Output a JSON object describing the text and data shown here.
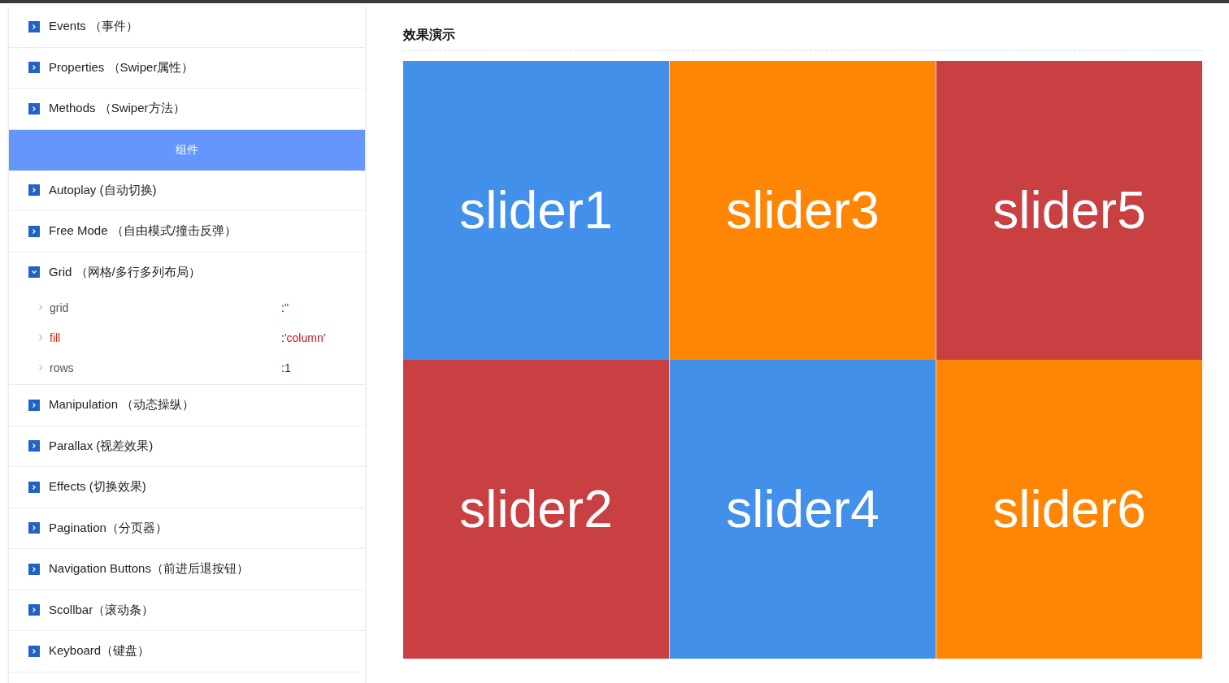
{
  "sidebar": {
    "items": [
      {
        "kind": "section",
        "label": "Events （事件）",
        "expanded": false
      },
      {
        "kind": "section",
        "label": "Properties （Swiper属性）",
        "expanded": false
      },
      {
        "kind": "section",
        "label": "Methods （Swiper方法）",
        "expanded": false
      },
      {
        "kind": "header",
        "label": "组件"
      },
      {
        "kind": "section",
        "label": "Autoplay (自动切换)",
        "expanded": false
      },
      {
        "kind": "section",
        "label": "Free Mode （自由模式/撞击反弹）",
        "expanded": false
      },
      {
        "kind": "section",
        "label": "Grid （网格/多行多列布局）",
        "expanded": true,
        "children": [
          {
            "key": "grid",
            "separator": ":",
            "value": "''",
            "kind": "string",
            "highlighted": false
          },
          {
            "key": "fill",
            "separator": ":",
            "value": "'column'",
            "kind": "string",
            "highlighted": true
          },
          {
            "key": "rows",
            "separator": ":",
            "value": "1",
            "kind": "number",
            "highlighted": false
          }
        ]
      },
      {
        "kind": "section",
        "label": "Manipulation （动态操纵）",
        "expanded": false
      },
      {
        "kind": "section",
        "label": "Parallax (视差效果)",
        "expanded": false
      },
      {
        "kind": "section",
        "label": "Effects (切换效果)",
        "expanded": false
      },
      {
        "kind": "section",
        "label": "Pagination（分页器）",
        "expanded": false
      },
      {
        "kind": "section",
        "label": "Navigation Buttons（前进后退按钮）",
        "expanded": false
      },
      {
        "kind": "section",
        "label": "Scollbar（滚动条）",
        "expanded": false
      },
      {
        "kind": "section",
        "label": "Keyboard（键盘）",
        "expanded": false
      }
    ]
  },
  "demo": {
    "title": "效果演示",
    "slides": [
      {
        "label": "slider1",
        "color": "#4390ea"
      },
      {
        "label": "slider2",
        "color": "#c94043"
      },
      {
        "label": "slider3",
        "color": "#ff8604"
      },
      {
        "label": "slider4",
        "color": "#4390ea"
      },
      {
        "label": "slider5",
        "color": "#c94043"
      },
      {
        "label": "slider6",
        "color": "#ff8604"
      }
    ]
  }
}
